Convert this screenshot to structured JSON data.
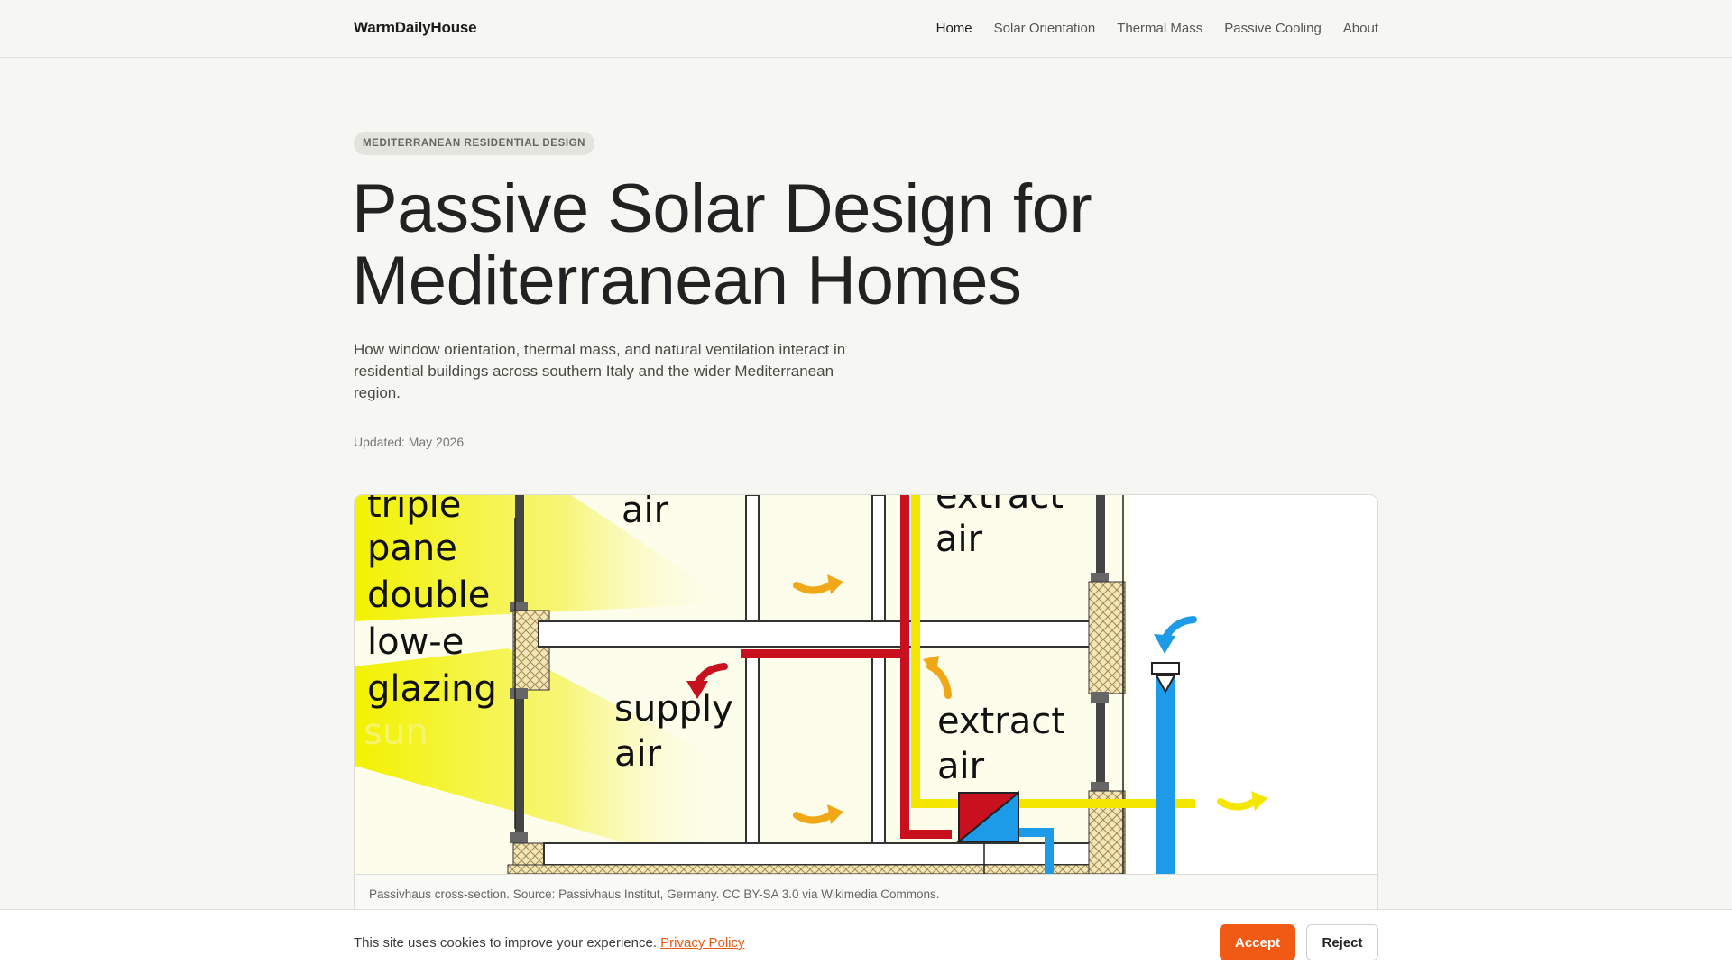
{
  "header": {
    "brand": "WarmDailyHouse",
    "nav": [
      "Home",
      "Solar Orientation",
      "Thermal Mass",
      "Passive Cooling",
      "About"
    ]
  },
  "article": {
    "tag": "MEDITERRANEAN RESIDENTIAL DESIGN",
    "title_line1": "Passive Solar Design for",
    "title_line2": "Mediterranean Homes",
    "subtitle": "How window orientation, thermal mass, and natural ventilation interact in residential buildings across southern Italy and the wider Mediterranean region.",
    "updated": "Updated: May 2026"
  },
  "figure": {
    "labels": {
      "triple": "triple",
      "pane": "pane",
      "double": "double",
      "lowe": "low-e",
      "glazing": "glazing",
      "sun": "sun",
      "air_top": "air",
      "extract_top": "extract",
      "extract_top_air": "air",
      "supply": "supply",
      "supply_air": "air",
      "extract": "extract",
      "extract_air": "air"
    },
    "caption": "Passivhaus cross-section. Source: Passivhaus Institut, Germany. CC BY-SA 3.0 via Wikimedia Commons.",
    "colors": {
      "sun": "#f2f200",
      "supply_duct": "#c8101e",
      "extract_duct": "#f5e600",
      "fresh_duct": "#1e9be8",
      "arrow_orange": "#f0a818",
      "insulation": "#f5e6b8",
      "wall_fill": "#fdfdec"
    }
  },
  "cookie": {
    "text": "This site uses cookies to improve your experience.",
    "link": "Privacy Policy",
    "accept": "Accept",
    "reject": "Reject"
  }
}
